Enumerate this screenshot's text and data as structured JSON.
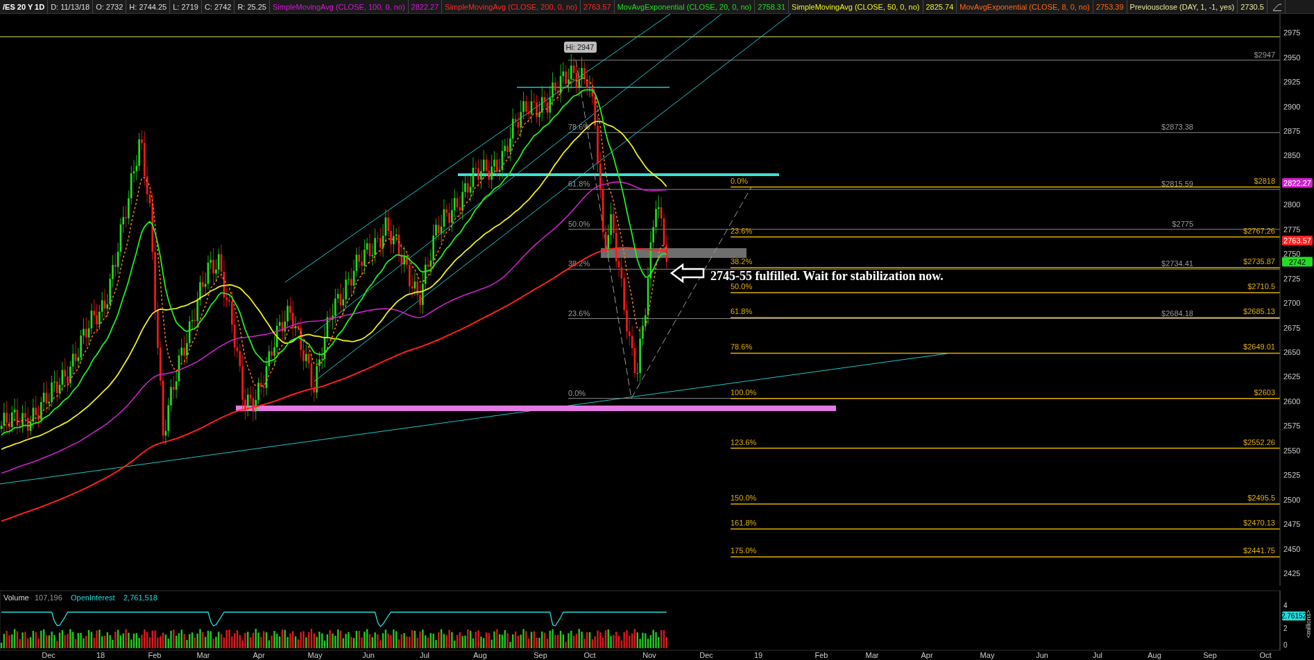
{
  "header": {
    "symbol": "/ES 20 Y 1D",
    "fields": [
      "D: 11/13/18",
      "O: 2732",
      "H: 2744.25",
      "L: 2719",
      "C: 2742",
      "R: 25.25"
    ],
    "studies": [
      {
        "name": "SimpleMovingAvg (CLOSE, 100, 0, no)",
        "value": "2822.27",
        "color": "#d81ad8"
      },
      {
        "name": "SimpleMovingAvg (CLOSE, 200, 0, no)",
        "value": "2763.57",
        "color": "#ff2a2a"
      },
      {
        "name": "MovAvgExponential (CLOSE, 20, 0, no)",
        "value": "2758.31",
        "color": "#22dd22"
      },
      {
        "name": "SimpleMovingAvg (CLOSE, 50, 0, no)",
        "value": "2825.74",
        "color": "#f0f020"
      },
      {
        "name": "MovAvgExponential (CLOSE, 8, 0, no)",
        "value": "2753.39",
        "color": "#ff6a1a"
      },
      {
        "name": "Previousclose (DAY, 1, -1, yes)",
        "value": "2730.5",
        "color": "#e8e8a0"
      }
    ]
  },
  "price_axis": {
    "ticks": [
      "2975",
      "2950",
      "2925",
      "2900",
      "2875",
      "2850",
      "2800",
      "2775",
      "2750",
      "2725",
      "2700",
      "2675",
      "2650",
      "2625",
      "2600",
      "2575",
      "2550",
      "2525",
      "2500",
      "2475",
      "2450",
      "2425"
    ],
    "badges": [
      {
        "text": "2822.27",
        "color": "#cc22cc"
      },
      {
        "text": "2763.57",
        "color": "#ff2020"
      },
      {
        "text": "2742",
        "color": "#22dd22"
      }
    ]
  },
  "hi_label": "Hi: 2947",
  "note": "2745-55 fulfilled. Wait for stabilization now.",
  "fib_grey": {
    "top_price": "$2947",
    "levels": [
      {
        "percent": "78.6%",
        "price": "$2873.38"
      },
      {
        "percent": "61.8%",
        "price": "$2815.59"
      },
      {
        "percent": "50.0%",
        "price": "$2775"
      },
      {
        "percent": "38.2%",
        "price": "$2734.41"
      },
      {
        "percent": "23.6%",
        "price": "$2684.18"
      },
      {
        "percent": "0.0%"
      }
    ]
  },
  "fib_yellow": {
    "levels": [
      {
        "percent": "0.0%",
        "price": "$2818"
      },
      {
        "percent": "23.6%",
        "price": "$2767.26"
      },
      {
        "percent": "38.2%",
        "price": "$2735.87"
      },
      {
        "percent": "50.0%",
        "price": "$2710.5"
      },
      {
        "percent": "61.8%",
        "price": "$2685.13"
      },
      {
        "percent": "78.6%",
        "price": "$2649.01"
      },
      {
        "percent": "100.0%",
        "price": "$2603"
      },
      {
        "percent": "123.6%",
        "price": "$2552.26"
      },
      {
        "percent": "150.0%",
        "price": "$2495.5"
      },
      {
        "percent": "161.8%",
        "price": "$2470.13"
      },
      {
        "percent": "175.0%",
        "price": "$2441.75"
      }
    ]
  },
  "volume_panel": {
    "volume_label": "Volume",
    "volume_value": "107,196",
    "oi_label": "OpenInterest",
    "oi_value": "2,761,518",
    "axis_ticks": [
      "4",
      "2",
      "0"
    ],
    "badge": "2.76152",
    "unit": "<millions>"
  },
  "time_axis": [
    "Dec",
    "18",
    "Feb",
    "Mar",
    "Apr",
    "May",
    "Jun",
    "Jul",
    "Aug",
    "Sep",
    "Oct",
    "Nov",
    "Dec",
    "19",
    "Feb",
    "Mar",
    "Apr",
    "May",
    "Jun",
    "Jul",
    "Aug",
    "Sep",
    "Oct"
  ]
}
